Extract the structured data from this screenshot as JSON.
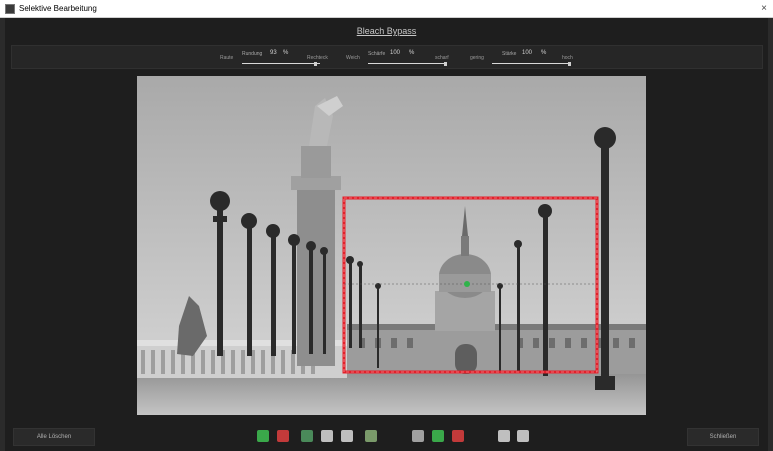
{
  "window": {
    "title": "Selektive Bearbeitung",
    "close_glyph": "×"
  },
  "preset": {
    "name": "Bleach Bypass"
  },
  "controls": {
    "group1": {
      "left_label": "Raute",
      "name": "Rundung",
      "value": "93",
      "unit": "%",
      "right_label": "Rechteck",
      "level": 0.93
    },
    "group2": {
      "left_label": "Weich",
      "name": "Schärfe",
      "value": "100",
      "unit": "%",
      "right_label": "scharf",
      "level": 1.0
    },
    "group3": {
      "left_label": "gering",
      "name": "Stärke",
      "value": "100",
      "unit": "%",
      "right_label": "hoch",
      "level": 1.0
    }
  },
  "bottom": {
    "delete_all_label": "Alle Löschen",
    "close_label": "Schließen"
  },
  "tools": [
    {
      "icon": "add-circle-selection-icon",
      "color": "#3aa84a"
    },
    {
      "icon": "add-red-selection-icon",
      "color": "#c23a3a"
    },
    {
      "icon": "brush-selection-icon",
      "color": "#3aa84a"
    },
    {
      "icon": "copy-selection-icon",
      "color": "#bfbfbf"
    },
    {
      "icon": "paste-selection-icon",
      "color": "#bfbfbf"
    },
    {
      "icon": "gradient-selection-icon",
      "color": "#7a9a6a"
    },
    {
      "icon": "show-mask-icon",
      "color": "#a0a0a0"
    },
    {
      "icon": "selection-green-icon",
      "color": "#3aa84a"
    },
    {
      "icon": "selection-red-green-icon",
      "color": "#c23a3a"
    },
    {
      "icon": "compare-before-icon",
      "color": "#bfbfbf"
    },
    {
      "icon": "compare-after-icon",
      "color": "#bfbfbf"
    }
  ],
  "colors": {
    "selection_frame": "#e3202a",
    "control_point": "#2fb34a"
  }
}
